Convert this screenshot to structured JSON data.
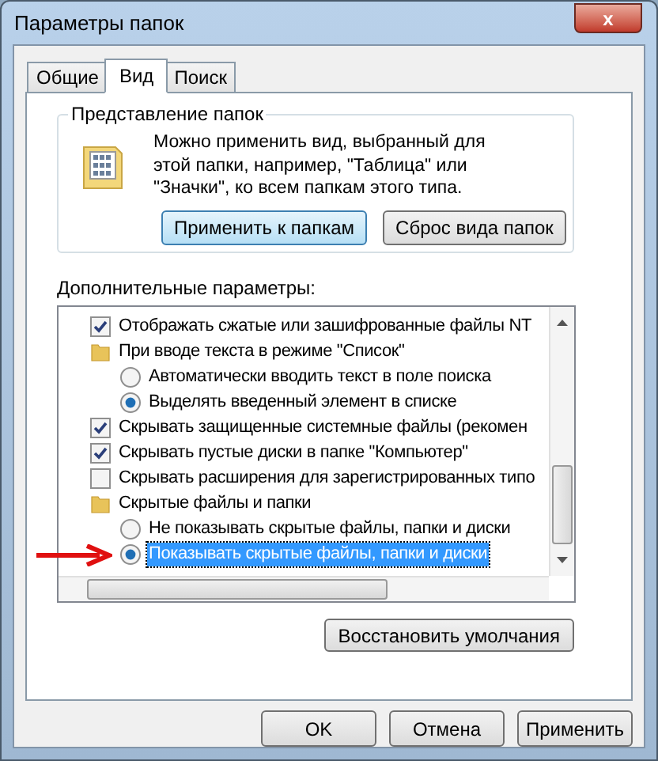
{
  "window": {
    "title": "Параметры папок",
    "close": "x"
  },
  "tabs": [
    {
      "label": "Общие",
      "selected": false
    },
    {
      "label": "Вид",
      "selected": true
    },
    {
      "label": "Поиск",
      "selected": false
    }
  ],
  "folder_views": {
    "title": "Представление папок",
    "description": "Можно применить вид, выбранный для этой папки, например, \"Таблица\" или \"Значки\", ко всем папкам этого типа.",
    "buttons": [
      {
        "label": "Применить к папкам",
        "focused": true
      },
      {
        "label": "Сброс вида папок",
        "focused": false
      }
    ]
  },
  "advanced": {
    "label": "Дополнительные параметры:",
    "items": [
      {
        "kind": "checkbox",
        "label": "Отображать сжатые или зашифрованные файлы NT",
        "checked": true,
        "selected": false
      },
      {
        "kind": "folder",
        "label": "При вводе текста в режиме \"Список\"",
        "selected": false,
        "children": [
          {
            "kind": "radio",
            "label": "Автоматически вводить текст в поле поиска",
            "checked": false,
            "selected": false
          },
          {
            "kind": "radio",
            "label": "Выделять введенный элемент в списке",
            "checked": true,
            "selected": false
          }
        ]
      },
      {
        "kind": "checkbox",
        "label": "Скрывать защищенные системные файлы (рекомен",
        "checked": true,
        "selected": false
      },
      {
        "kind": "checkbox",
        "label": "Скрывать пустые диски в папке \"Компьютер\"",
        "checked": true,
        "selected": false
      },
      {
        "kind": "checkbox",
        "label": "Скрывать расширения для зарегистрированных типо",
        "checked": false,
        "selected": false
      },
      {
        "kind": "folder",
        "label": "Скрытые файлы и папки",
        "selected": false,
        "children": [
          {
            "kind": "radio",
            "label": "Не показывать скрытые файлы, папки и диски",
            "checked": false,
            "selected": false
          },
          {
            "kind": "radio",
            "label": "Показывать скрытые файлы, папки и диски",
            "checked": true,
            "selected": true
          }
        ]
      }
    ],
    "restore_button": "Восстановить умолчания"
  },
  "buttons": [
    {
      "label": "OK"
    },
    {
      "label": "Отмена"
    },
    {
      "label": "Применить"
    }
  ]
}
